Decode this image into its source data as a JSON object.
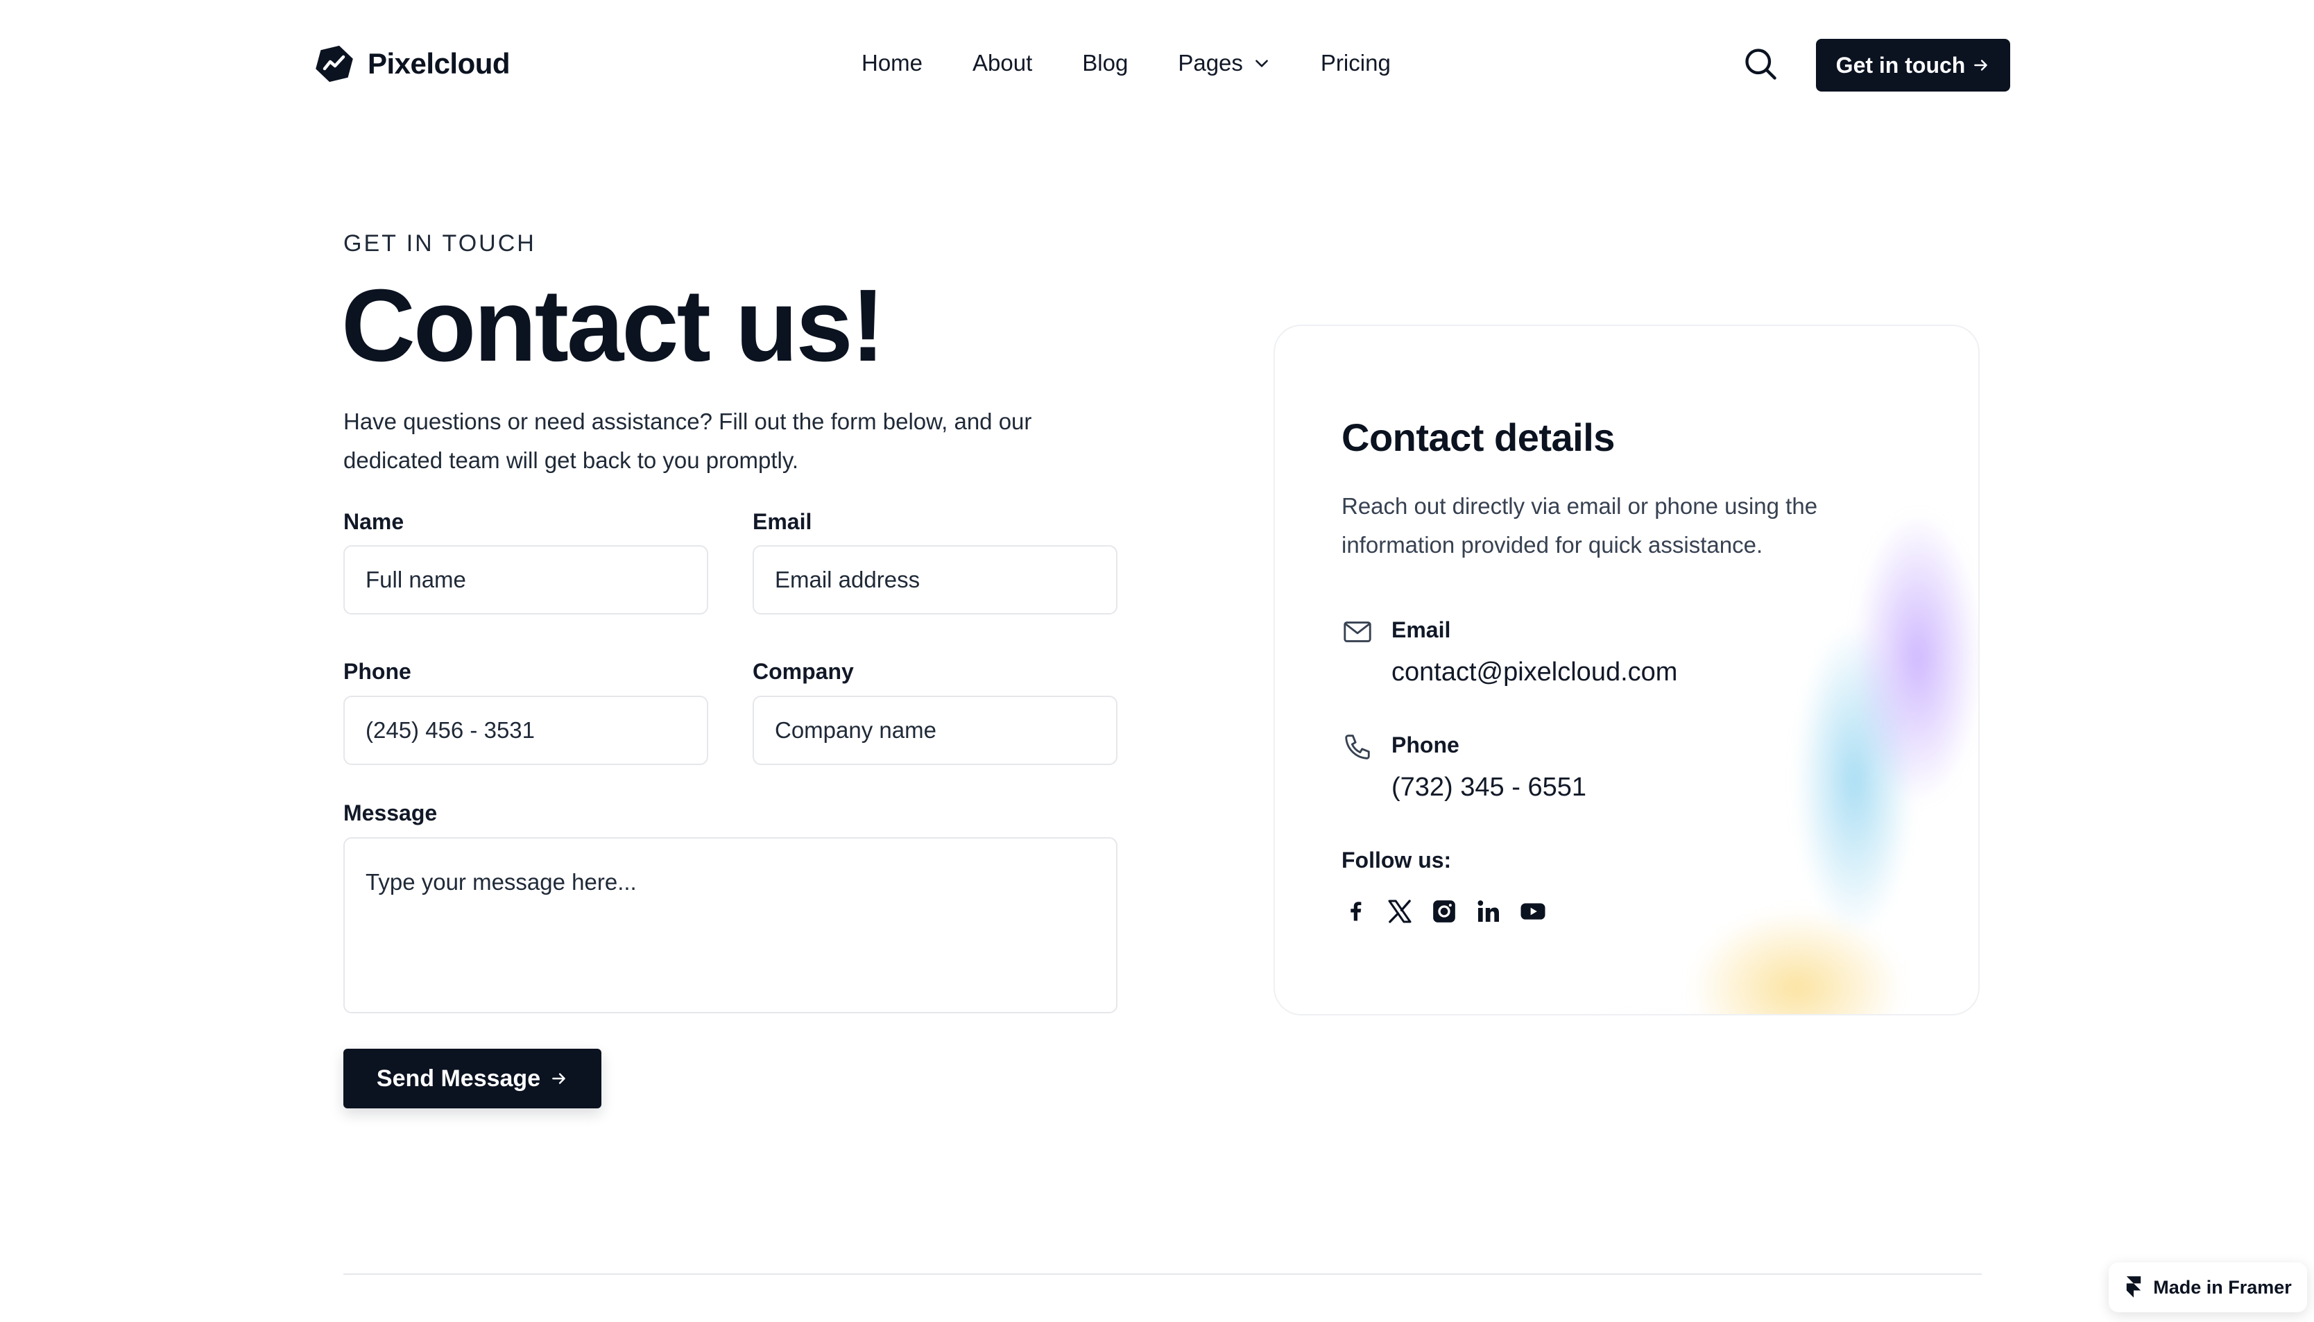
{
  "brand": {
    "name": "Pixelcloud"
  },
  "nav": {
    "items": [
      {
        "label": "Home"
      },
      {
        "label": "About"
      },
      {
        "label": "Blog"
      },
      {
        "label": "Pages",
        "has_dropdown": true
      },
      {
        "label": "Pricing"
      }
    ],
    "cta_label": "Get in touch"
  },
  "hero": {
    "eyebrow": "GET IN TOUCH",
    "title": "Contact us!",
    "intro": "Have questions or need assistance? Fill out the form below, and our dedicated team will get back to you promptly."
  },
  "form": {
    "name_label": "Name",
    "name_placeholder": "Full name",
    "email_label": "Email",
    "email_placeholder": "Email address",
    "phone_label": "Phone",
    "phone_placeholder": "(245) 456 - 3531",
    "company_label": "Company",
    "company_placeholder": "Company name",
    "message_label": "Message",
    "message_placeholder": "Type your message here...",
    "submit_label": "Send Message"
  },
  "contact_card": {
    "title": "Contact details",
    "description": "Reach out directly via email or phone using the information provided for quick assistance.",
    "email_label": "Email",
    "email_value": "contact@pixelcloud.com",
    "phone_label": "Phone",
    "phone_value": "(732) 345 - 6551",
    "follow_label": "Follow us:",
    "socials": [
      "facebook-icon",
      "x-icon",
      "instagram-icon",
      "linkedin-icon",
      "youtube-icon"
    ]
  },
  "badge": {
    "label": "Made in Framer"
  },
  "colors": {
    "primary": "#0b1220",
    "border": "#e5e7eb",
    "text_muted": "#374151"
  }
}
